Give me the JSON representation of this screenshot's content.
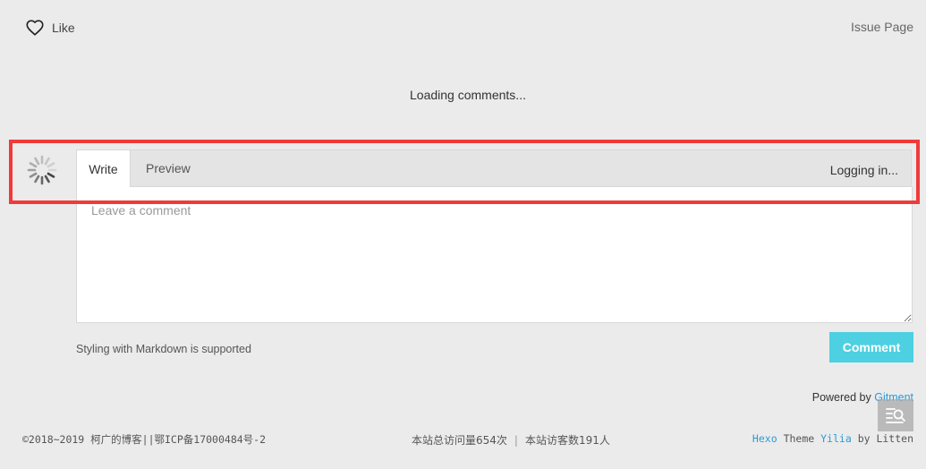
{
  "like": {
    "icon": "heart-outline-icon",
    "label": "Like"
  },
  "issue_link": {
    "label": "Issue Page"
  },
  "status": {
    "loading_comments": "Loading comments..."
  },
  "editor": {
    "avatar_icon": "loading-spinner-icon",
    "tabs": [
      {
        "label": "Write",
        "active": true
      },
      {
        "label": "Preview",
        "active": false
      }
    ],
    "login_status": "Logging in...",
    "textarea": {
      "value": "",
      "placeholder": "Leave a comment"
    },
    "markdown_note": "Styling with Markdown is supported",
    "submit_label": "Comment"
  },
  "powered_by": {
    "prefix": "Powered by",
    "link": "Gitment"
  },
  "search_toggle": {
    "icon": "search-list-icon"
  },
  "footer": {
    "copyright": "©2018~2019 柯广的博客||鄂ICP备17000484号-2",
    "site_pv": "本站总访问量654次",
    "separator": "|",
    "site_uv": "本站访客数191人",
    "theme": {
      "hexo": "Hexo",
      "theme_word": "Theme",
      "yilia": "Yilia",
      "by": "by Litten"
    }
  },
  "colors": {
    "background": "#ebebeb",
    "highlight": "#f03a3a",
    "accent": "#4dd0e1",
    "link": "#2a9bd5"
  }
}
